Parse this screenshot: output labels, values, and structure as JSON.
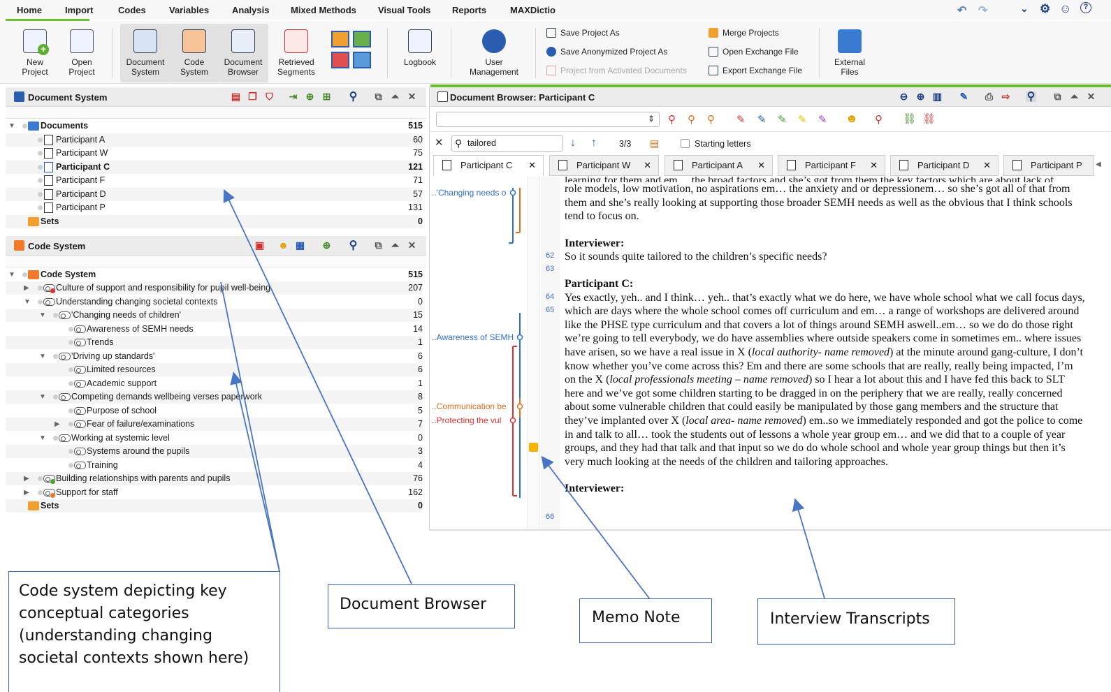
{
  "menu": {
    "items": [
      "Home",
      "Import",
      "Codes",
      "Variables",
      "Analysis",
      "Mixed Methods",
      "Visual Tools",
      "Reports",
      "MAXDictio"
    ]
  },
  "ribbon": {
    "new_project": "New\nProject",
    "open_project": "Open\nProject",
    "document_system": "Document\nSystem",
    "code_system": "Code\nSystem",
    "document_browser": "Document\nBrowser",
    "retrieved_segments": "Retrieved\nSegments",
    "logbook": "Logbook",
    "user_management": "User\nManagement",
    "external_files": "External\nFiles",
    "save_project_as": "Save Project As",
    "save_anonymized": "Save Anonymized Project As",
    "project_from_activated": "Project from Activated Documents",
    "merge_projects": "Merge Projects",
    "open_exchange": "Open Exchange File",
    "export_exchange": "Export Exchange File"
  },
  "document_system": {
    "title": "Document System",
    "root": {
      "label": "Documents",
      "count": "515"
    },
    "items": [
      {
        "label": "Participant A",
        "count": "60"
      },
      {
        "label": "Participant W",
        "count": "75"
      },
      {
        "label": "Participant C",
        "count": "121"
      },
      {
        "label": "Participant F",
        "count": "71"
      },
      {
        "label": "Participant D",
        "count": "57"
      },
      {
        "label": "Participant P",
        "count": "131"
      }
    ],
    "sets": {
      "label": "Sets",
      "count": "0"
    }
  },
  "code_system": {
    "title": "Code System",
    "root": {
      "label": "Code System",
      "count": "515"
    },
    "items": [
      {
        "label": "Culture of support and responsibility for pupil well-being",
        "count": "207"
      },
      {
        "label": "Understanding changing societal contexts",
        "count": "0"
      },
      {
        "label": "'Changing needs of children'",
        "count": "15"
      },
      {
        "label": "Awareness of SEMH needs",
        "count": "14"
      },
      {
        "label": "Trends",
        "count": "1"
      },
      {
        "label": "'Driving up standards'",
        "count": "6"
      },
      {
        "label": "Limited resources",
        "count": "6"
      },
      {
        "label": "Academic support",
        "count": "1"
      },
      {
        "label": "Competing demands wellbeing verses paperwork",
        "count": "8"
      },
      {
        "label": "Purpose of school",
        "count": "5"
      },
      {
        "label": "Fear of failure/examinations",
        "count": "7"
      },
      {
        "label": "Working at systemic level",
        "count": "0"
      },
      {
        "label": "Systems around the pupils",
        "count": "3"
      },
      {
        "label": "Training",
        "count": "4"
      },
      {
        "label": "Building relationships with parents and pupils",
        "count": "76"
      },
      {
        "label": "Support for staff",
        "count": "162"
      }
    ],
    "sets": {
      "label": "Sets",
      "count": "0"
    }
  },
  "document_browser": {
    "title": "Document Browser: Participant C",
    "search": {
      "value": "tailored",
      "counter": "3/3",
      "starting_letters": "Starting letters"
    },
    "tabs": [
      "Participant C",
      "Participant W",
      "Participant A",
      "Participant F",
      "Participant D",
      "Participant P"
    ],
    "code_labels": [
      "..'Changing needs o",
      "..Awareness of SEMH",
      "..Communication be",
      "..Protecting the vul"
    ],
    "line_numbers": [
      "62",
      "63",
      "64",
      "65",
      "66"
    ],
    "transcript": {
      "top_cut": "learning for them and em… the broad factors and she’s got from them the key factors which are about lack of",
      "p1": "role models, low motivation, no aspirations em… the anxiety and or depressionem… so she’s got all of that from them and she’s really looking at supporting those broader SEMH needs as well as the obvious that I think schools tend to focus on.",
      "interviewer": "Interviewer:",
      "q1": "So it sounds quite tailored to the children’s specific needs?",
      "participant": "Participant C:",
      "a1_1": "Yes exactly, yeh.. and I think… yeh.. that’s exactly what we do here, we have whole school what we call focus days, which are days where the whole school comes off curriculum and em… a range of workshops are delivered around like the PHSE type curriculum and that covers a lot of things around SEMH aswell..em… so we do do those right we’re going to tell everybody, we do have assemblies where outside speakers come in sometimes em..  where issues have arisen, so we have a real issue in X (",
      "a1_i1": "local authority- name removed",
      "a1_2": ") at the minute around gang-culture, I don’t know whether you’ve come across this? Em and there are some schools that are really, really being impacted, I’m on the X (",
      "a1_i2": "local professionals meeting – name removed",
      "a1_3": ") so I hear a lot about this and I have fed this back to SLT here and we’ve got some children starting to be dragged in on the periphery that we are really, really concerned about some vulnerable children that could easily be manipulated by those gang members and the structure that they’ve implanted over X (",
      "a1_i3": "local area- name removed",
      "a1_4": ") em..so we immediately responded and got the police to come in and talk to all… took the students out of lessons a whole year group em… and we did that to a couple of year groups, and they had that talk and that input so we do do whole school and whole year group things but then it’s very much looking at the needs of the children and tailoring approaches.",
      "interviewer2": "Interviewer:"
    }
  },
  "annotations": {
    "code_system": "Code system depicting key conceptual categories (understanding changing societal contexts shown here)",
    "document_browser": "Document Browser",
    "memo_note": "Memo Note",
    "interview_transcripts": "Interview Transcripts"
  },
  "colors": {
    "accent": "#6abf2f",
    "arrow": "#4a74c4",
    "code_blue": "#2f6fd0",
    "code_orange": "#e07020",
    "code_red": "#e03030"
  }
}
